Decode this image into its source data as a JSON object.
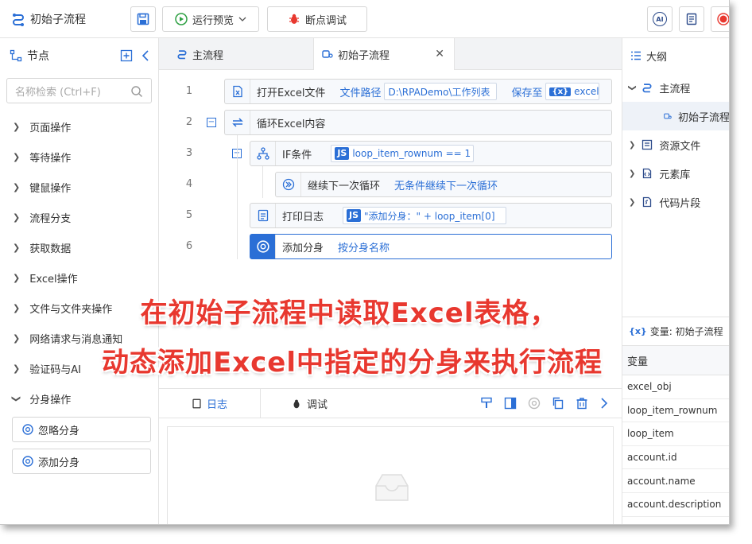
{
  "app": {
    "title": "初始子流程"
  },
  "toolbar": {
    "run_label": "运行预览",
    "debug_label": "断点调试",
    "ai_label": "AI"
  },
  "left": {
    "header": "节点",
    "search_placeholder": "名称检索 (Ctrl+F)",
    "items": [
      {
        "label": "页面操作"
      },
      {
        "label": "等待操作"
      },
      {
        "label": "键鼠操作"
      },
      {
        "label": "流程分支"
      },
      {
        "label": "获取数据"
      },
      {
        "label": "Excel操作"
      },
      {
        "label": "文件与文件夹操作"
      },
      {
        "label": "网络请求与消息通知"
      },
      {
        "label": "验证码与AI"
      },
      {
        "label": "分身操作"
      }
    ],
    "sub_items": [
      {
        "label": "忽略分身"
      },
      {
        "label": "添加分身"
      }
    ]
  },
  "tabs": [
    {
      "label": "主流程"
    },
    {
      "label": "初始子流程"
    }
  ],
  "editor": {
    "lines": [
      "1",
      "2",
      "3",
      "4",
      "5",
      "6"
    ],
    "row1": {
      "title": "打开Excel文件",
      "kw1": "文件路径",
      "path": "D:\\RPADemo\\工作列表",
      "kw2": "保存至",
      "var": "excel_o"
    },
    "row2": {
      "title": "循环Excel内容"
    },
    "row3": {
      "title": "IF条件",
      "js": "JS",
      "expr": "loop_item_rownum == 1"
    },
    "row4": {
      "title": "继续下一次循环",
      "kw": "无条件继续下一次循环"
    },
    "row5": {
      "title": "打印日志",
      "js": "JS",
      "expr": "\"添加分身：\" + loop_item[0]"
    },
    "row6": {
      "title": "添加分身",
      "kw": "按分身名称"
    }
  },
  "log": {
    "tab_log": "日志",
    "tab_debug": "调试"
  },
  "right": {
    "header": "大纲",
    "outline": [
      {
        "label": "主流程"
      },
      {
        "label": "初始子流程"
      },
      {
        "label": "资源文件"
      },
      {
        "label": "元素库"
      },
      {
        "label": "代码片段"
      }
    ],
    "var_header": "变量: 初始子流程",
    "var_title": "变量",
    "vars": [
      "excel_obj",
      "loop_item_rownum",
      "loop_item",
      "account.id",
      "account.name",
      "account.description"
    ]
  },
  "overlay": {
    "line1": "在初始子流程中读取Excel表格，",
    "line2": "动态添加Excel中指定的分身来执行流程"
  },
  "colors": {
    "accent": "#2b6fd6",
    "overlay": "#e8382f"
  }
}
